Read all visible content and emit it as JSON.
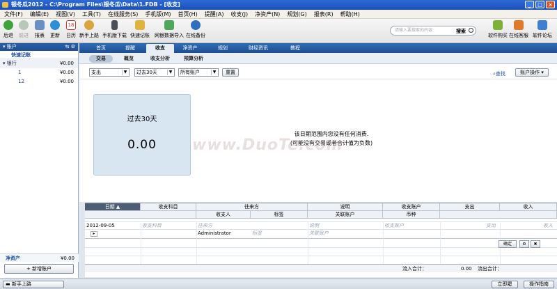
{
  "window": {
    "title": "银冬瓜2012 - C:\\Program Files\\银冬瓜\\Data\\1.FDB - [收支]"
  },
  "menu": [
    "文件(F)",
    "编辑(E)",
    "视图(V)",
    "工具(T)",
    "在线服务(S)",
    "手机版(M)",
    "首页(H)",
    "提醒(A)",
    "收支(J)",
    "净资产(N)",
    "规划(G)",
    "报表(R)",
    "帮助(H)"
  ],
  "toolbar": {
    "items": [
      {
        "label": "后退",
        "icon": "back-arrow-icon"
      },
      {
        "label": "前进",
        "icon": "forward-arrow-icon"
      },
      {
        "label": "报表",
        "icon": "report-icon"
      },
      {
        "label": "更新",
        "icon": "refresh-icon"
      },
      {
        "label": "日历",
        "icon": "calendar-icon"
      },
      {
        "label": "新手上路",
        "icon": "beginner-icon"
      },
      {
        "label": "手机版下载",
        "icon": "mobile-download-icon"
      },
      {
        "label": "快速记账",
        "icon": "quick-entry-icon"
      },
      {
        "label": "网银数据导入",
        "icon": "bank-import-icon"
      },
      {
        "label": "在线备份",
        "icon": "online-backup-icon"
      }
    ],
    "search_placeholder": "请输入要搜索的内容",
    "search_button": "搜索",
    "right_items": [
      "软件购买",
      "在线客服",
      "软件论坛"
    ]
  },
  "sidebar": {
    "header": "账户",
    "quick_entry": "快速记账",
    "group": {
      "label": "银行",
      "amount": "¥0.00"
    },
    "rows": [
      {
        "label": "1",
        "amount": "¥0.00"
      },
      {
        "label": "12",
        "amount": "¥0.00"
      }
    ],
    "net_label": "净资产",
    "net_amount": "¥0.00",
    "add_button": "+ 新增账户"
  },
  "tabs": [
    "首页",
    "提醒",
    "收支",
    "净资产",
    "规划",
    "财经资讯",
    "教程"
  ],
  "active_tab": "收支",
  "subtabs": [
    "交易",
    "概览",
    "收支分析",
    "预算分析"
  ],
  "filters": {
    "type": "支出",
    "period": "过去30天",
    "account": "所有账户",
    "reset": "重置",
    "find": "查找",
    "account_ops": "账户操作"
  },
  "summary": {
    "label": "过去30天",
    "value": "0.00"
  },
  "empty_message": {
    "line1": "该日期范围内您没有任何消费.",
    "line2": "(可能没有交易或者合计值为负数)"
  },
  "grid": {
    "headers_row1": [
      "日期",
      "收支科目",
      "往来方",
      "说明",
      "收支账户",
      "支出",
      "收入"
    ],
    "headers_row2": [
      "收支人",
      "标签",
      "关联账户",
      "币种"
    ],
    "entry": {
      "date": "2012-09-05",
      "category_ph": "收支科目",
      "party_ph": "往来方",
      "desc_ph": "说明",
      "account_ph": "收支账户",
      "expense_ph": "支出",
      "income_ph": "收入",
      "person": "Administrator",
      "tag_ph": "标签",
      "linked_ph": "关联账户"
    },
    "confirm_button": "确定",
    "totals": {
      "in_label": "流入合计：",
      "in_value": "0.00",
      "out_label": "流出合计："
    }
  },
  "status": {
    "left_button": "新手上路",
    "now_button": "立即罷",
    "guide_button": "操作指南"
  }
}
